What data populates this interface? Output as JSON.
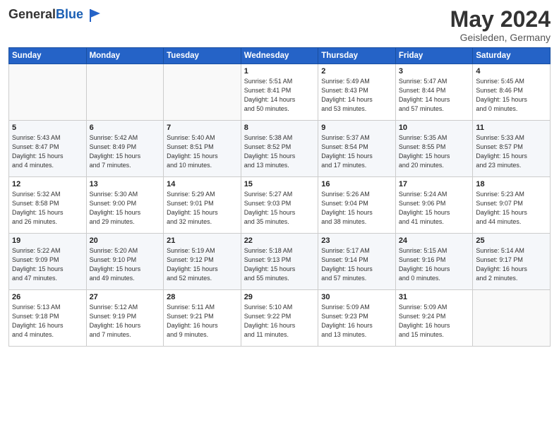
{
  "header": {
    "logo_general": "General",
    "logo_blue": "Blue",
    "month_year": "May 2024",
    "location": "Geisleden, Germany"
  },
  "weekdays": [
    "Sunday",
    "Monday",
    "Tuesday",
    "Wednesday",
    "Thursday",
    "Friday",
    "Saturday"
  ],
  "weeks": [
    [
      {
        "day": "",
        "info": ""
      },
      {
        "day": "",
        "info": ""
      },
      {
        "day": "",
        "info": ""
      },
      {
        "day": "1",
        "info": "Sunrise: 5:51 AM\nSunset: 8:41 PM\nDaylight: 14 hours\nand 50 minutes."
      },
      {
        "day": "2",
        "info": "Sunrise: 5:49 AM\nSunset: 8:43 PM\nDaylight: 14 hours\nand 53 minutes."
      },
      {
        "day": "3",
        "info": "Sunrise: 5:47 AM\nSunset: 8:44 PM\nDaylight: 14 hours\nand 57 minutes."
      },
      {
        "day": "4",
        "info": "Sunrise: 5:45 AM\nSunset: 8:46 PM\nDaylight: 15 hours\nand 0 minutes."
      }
    ],
    [
      {
        "day": "5",
        "info": "Sunrise: 5:43 AM\nSunset: 8:47 PM\nDaylight: 15 hours\nand 4 minutes."
      },
      {
        "day": "6",
        "info": "Sunrise: 5:42 AM\nSunset: 8:49 PM\nDaylight: 15 hours\nand 7 minutes."
      },
      {
        "day": "7",
        "info": "Sunrise: 5:40 AM\nSunset: 8:51 PM\nDaylight: 15 hours\nand 10 minutes."
      },
      {
        "day": "8",
        "info": "Sunrise: 5:38 AM\nSunset: 8:52 PM\nDaylight: 15 hours\nand 13 minutes."
      },
      {
        "day": "9",
        "info": "Sunrise: 5:37 AM\nSunset: 8:54 PM\nDaylight: 15 hours\nand 17 minutes."
      },
      {
        "day": "10",
        "info": "Sunrise: 5:35 AM\nSunset: 8:55 PM\nDaylight: 15 hours\nand 20 minutes."
      },
      {
        "day": "11",
        "info": "Sunrise: 5:33 AM\nSunset: 8:57 PM\nDaylight: 15 hours\nand 23 minutes."
      }
    ],
    [
      {
        "day": "12",
        "info": "Sunrise: 5:32 AM\nSunset: 8:58 PM\nDaylight: 15 hours\nand 26 minutes."
      },
      {
        "day": "13",
        "info": "Sunrise: 5:30 AM\nSunset: 9:00 PM\nDaylight: 15 hours\nand 29 minutes."
      },
      {
        "day": "14",
        "info": "Sunrise: 5:29 AM\nSunset: 9:01 PM\nDaylight: 15 hours\nand 32 minutes."
      },
      {
        "day": "15",
        "info": "Sunrise: 5:27 AM\nSunset: 9:03 PM\nDaylight: 15 hours\nand 35 minutes."
      },
      {
        "day": "16",
        "info": "Sunrise: 5:26 AM\nSunset: 9:04 PM\nDaylight: 15 hours\nand 38 minutes."
      },
      {
        "day": "17",
        "info": "Sunrise: 5:24 AM\nSunset: 9:06 PM\nDaylight: 15 hours\nand 41 minutes."
      },
      {
        "day": "18",
        "info": "Sunrise: 5:23 AM\nSunset: 9:07 PM\nDaylight: 15 hours\nand 44 minutes."
      }
    ],
    [
      {
        "day": "19",
        "info": "Sunrise: 5:22 AM\nSunset: 9:09 PM\nDaylight: 15 hours\nand 47 minutes."
      },
      {
        "day": "20",
        "info": "Sunrise: 5:20 AM\nSunset: 9:10 PM\nDaylight: 15 hours\nand 49 minutes."
      },
      {
        "day": "21",
        "info": "Sunrise: 5:19 AM\nSunset: 9:12 PM\nDaylight: 15 hours\nand 52 minutes."
      },
      {
        "day": "22",
        "info": "Sunrise: 5:18 AM\nSunset: 9:13 PM\nDaylight: 15 hours\nand 55 minutes."
      },
      {
        "day": "23",
        "info": "Sunrise: 5:17 AM\nSunset: 9:14 PM\nDaylight: 15 hours\nand 57 minutes."
      },
      {
        "day": "24",
        "info": "Sunrise: 5:15 AM\nSunset: 9:16 PM\nDaylight: 16 hours\nand 0 minutes."
      },
      {
        "day": "25",
        "info": "Sunrise: 5:14 AM\nSunset: 9:17 PM\nDaylight: 16 hours\nand 2 minutes."
      }
    ],
    [
      {
        "day": "26",
        "info": "Sunrise: 5:13 AM\nSunset: 9:18 PM\nDaylight: 16 hours\nand 4 minutes."
      },
      {
        "day": "27",
        "info": "Sunrise: 5:12 AM\nSunset: 9:19 PM\nDaylight: 16 hours\nand 7 minutes."
      },
      {
        "day": "28",
        "info": "Sunrise: 5:11 AM\nSunset: 9:21 PM\nDaylight: 16 hours\nand 9 minutes."
      },
      {
        "day": "29",
        "info": "Sunrise: 5:10 AM\nSunset: 9:22 PM\nDaylight: 16 hours\nand 11 minutes."
      },
      {
        "day": "30",
        "info": "Sunrise: 5:09 AM\nSunset: 9:23 PM\nDaylight: 16 hours\nand 13 minutes."
      },
      {
        "day": "31",
        "info": "Sunrise: 5:09 AM\nSunset: 9:24 PM\nDaylight: 16 hours\nand 15 minutes."
      },
      {
        "day": "",
        "info": ""
      }
    ]
  ]
}
